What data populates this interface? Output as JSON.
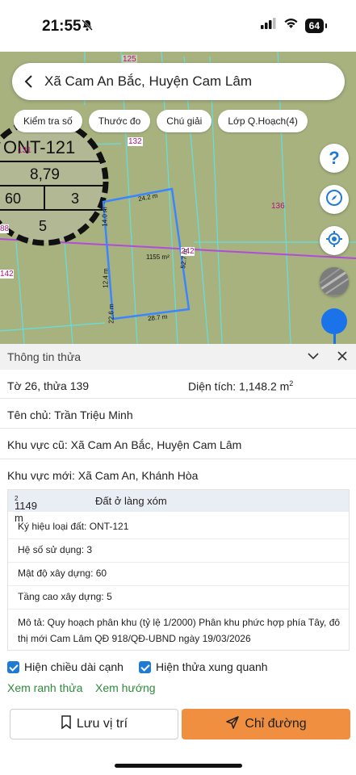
{
  "status": {
    "time": "21:55",
    "battery": "64"
  },
  "search": {
    "location": "Xã Cam An Bắc, Huyện Cam Lâm"
  },
  "chips": [
    "Kiểm tra số",
    "Thước đo",
    "Chú giải",
    "Lớp Q.Hoạch(4)"
  ],
  "map": {
    "plot_code": "ONT-121",
    "coef_value": "8,79",
    "density_value": "60",
    "height_value": "3",
    "floors_value": "5",
    "labels": [
      "125",
      "131",
      "132",
      "136",
      "88",
      "142",
      "242"
    ],
    "edges": [
      "24.2 m",
      "14.0 m",
      "52.7 m",
      "12.4 m",
      "28.7 m",
      "22.6 m"
    ],
    "area_label": "1155 m²",
    "help_symbol": "?"
  },
  "info": {
    "title": "Thông tin thửa",
    "sheet": "Tờ 26, thửa 139",
    "area_label": "Diện tích: 1,148.2 m",
    "area_sup": "2",
    "owner": "Tên chủ: Trần Triệu Minh",
    "old_area": "Khu vực cũ: Xã Cam An Bắc, Huyện Cam Lâm",
    "new_area": "Khu vực mới: Xã Cam An, Khánh Hòa"
  },
  "detail": {
    "area": "1149 m",
    "area_sup": "2",
    "land_type": "Đất ở làng xóm",
    "symbol": "Ký hiệu loại đất: ONT-121",
    "coef": "Hệ số sử dụng: 3",
    "density": "Mật độ xây dựng: 60",
    "floors": "Tầng cao xây dựng: 5",
    "desc_line1": "Mô tả: Quy hoạch phân khu (tỷ lệ 1/2000) Phân khu phức hợp phía Tây, đô",
    "desc_line2": "thị mới Cam Lâm QĐ 918/QĐ-UBND ngày 19/03/2026"
  },
  "options": {
    "show_edges": "Hiện chiều dài cạnh",
    "show_neighbors": "Hiện thửa xung quanh"
  },
  "links": {
    "boundary": "Xem ranh thửa",
    "direction": "Xem hướng"
  },
  "buttons": {
    "save": "Lưu vị trí",
    "directions": "Chỉ đường"
  },
  "colors": {
    "accent": "#1f7ad6",
    "primary_button": "#ef8f3f",
    "link": "#2e8b3a",
    "map_bg": "#a7b27f",
    "parcel": "#3a86ff"
  }
}
